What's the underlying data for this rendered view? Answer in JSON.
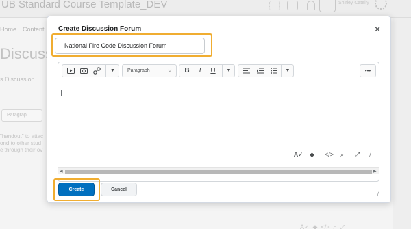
{
  "background": {
    "course_title": "UB Standard Course Template_DEV",
    "user_name": "Shirley Catelly",
    "nav_home": "Home",
    "nav_content": "Content",
    "page_heading": "Discussio",
    "sub_text": "s Discussion",
    "paragraph_field": "Paragrap",
    "body_line1": "\"handout\" to attac",
    "body_line2": "ond to other stud",
    "body_line3": "e through their ov"
  },
  "modal": {
    "title": "Create Discussion Forum",
    "close_icon": "close-icon",
    "title_input_value": "National Fire Code Discussion Forum",
    "highlight_color": "#f0ad31",
    "editor": {
      "format_select": "Paragraph",
      "toolbar_icons": [
        "video-icon",
        "camera-icon",
        "link-icon",
        "dropdown-icon",
        "bold-icon",
        "italic-icon",
        "underline-icon",
        "align-icon",
        "indent-icon",
        "list-icon",
        "more-icon"
      ],
      "bold_label": "B",
      "italic_label": "I",
      "underline_label": "U",
      "more_label": "•••"
    },
    "create_label": "Create",
    "cancel_label": "Cancel",
    "create_color": "#006fbf"
  }
}
